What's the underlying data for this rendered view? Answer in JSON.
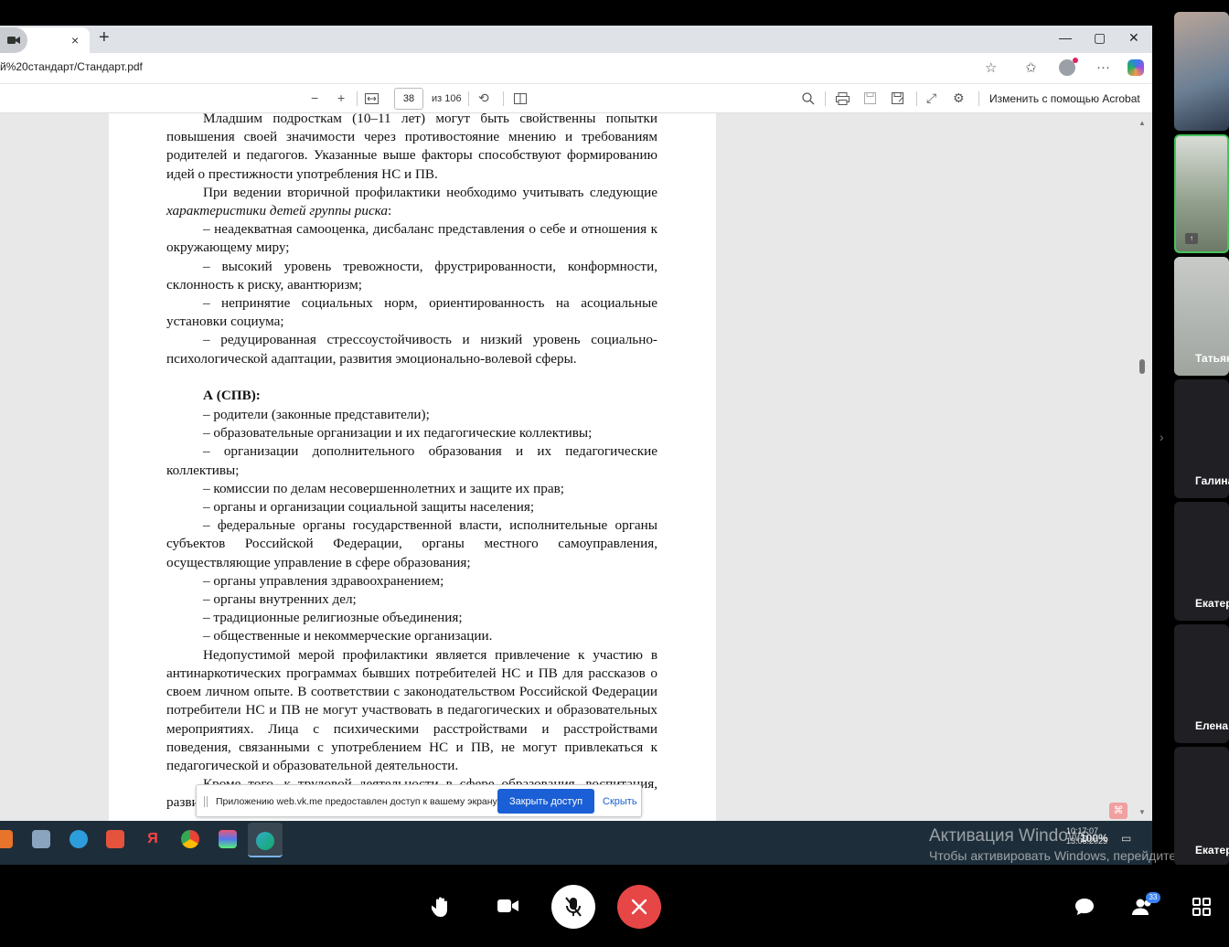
{
  "browser": {
    "url": "й%20стандарт/Стандарт.pdf",
    "new_tab": "+",
    "tab_close": "×",
    "win_min": "—",
    "win_max": "▢",
    "win_close": "✕"
  },
  "pdf_toolbar": {
    "zoom_out": "−",
    "zoom_in": "+",
    "page_current": "38",
    "page_total": "из 106",
    "edit_label": "Изменить с помощью Acrobat"
  },
  "document": {
    "p1": "Младшим подросткам (10–11 лет) могут быть свойственны попытки повышения своей значимости через противостояние мнению и требованиям родителей и педагогов. Указанные выше факторы способствуют формированию идей о престижности употребления НС и ПВ.",
    "p2_a": "При ведении вторичной профилактики необходимо учитывать следующие ",
    "p2_b": "характеристики детей группы риска",
    "p2_c": ":",
    "b1": "–   неадекватная   самооценка,   дисбаланс   представления   о   себе и отношения к окружающему миру;",
    "b2": "–   высокий уровень тревожности, фрустрированности, конформности, склонность к риску, авантюризм;",
    "b3": "–   непринятие социальных норм, ориентированность на асоциальные установки социума;",
    "b4": "–   редуцированная стрессоустойчивость и низкий уровень социально-психологической адаптации, развития эмоционально-волевой сферы.",
    "heading": "А (СПВ):",
    "l1": "–   родители (законные представители);",
    "l2": "–   образовательные организации и их педагогические коллективы;",
    "l3": "–   организации дополнительного образования и их педагогические коллективы;",
    "l4": "–   комиссии по делам несовершеннолетних и защите их прав;",
    "l5": "–   органы и организации социальной защиты населения;",
    "l6": "–   федеральные органы государственной власти, исполнительные органы субъектов Российской Федерации, органы местного самоуправления, осуществляющие управление в сфере образования;",
    "l7": "–   органы управления здравоохранением;",
    "l8": "–   органы внутренних дел;",
    "l9": "–   традиционные религиозные объединения;",
    "l10": "–   общественные и некоммерческие организации.",
    "p3": "Недопустимой мерой профилактики является привлечение к участию в антинаркотических программах бывших потребителей НС и ПВ для рассказов о своем личном опыте. В соответствии с законодательством Российской Федерации потребители НС и ПВ не могут участвовать в педагогических и образовательных мероприятиях. Лица с психическими расстройствами и расстройствами поведения, связанными с употреблением НС и ПВ, не могут привлекаться к педагогической и образовательной деятельности.",
    "p4": "Кроме того, к трудовой деятельности в сфере образования, воспитания, разви"
  },
  "share_notice": {
    "message": "Приложению web.vk.me предоставлен доступ к вашему экрану.",
    "stop_button": "Закрыть доступ",
    "hide_link": "Скрыть"
  },
  "taskbar": {
    "zoom": "100%",
    "time": "10:17:07",
    "date": "13.06.2025"
  },
  "watermark": {
    "title": "Активация Windows",
    "subtitle": "Чтобы активировать Windows, перейдите в раздел"
  },
  "participants": [
    {
      "name": ""
    },
    {
      "name": ""
    },
    {
      "name": "Татьяна"
    },
    {
      "name": "Галина"
    },
    {
      "name": "Екатерина"
    },
    {
      "name": "Елена"
    },
    {
      "name": "Екатерина"
    }
  ],
  "call": {
    "participant_count": "33"
  },
  "colors": {
    "accent": "#1a5fd6",
    "hangup": "#e64646",
    "active_speaker": "#46c35a",
    "taskbar": "#1d2e3a"
  }
}
